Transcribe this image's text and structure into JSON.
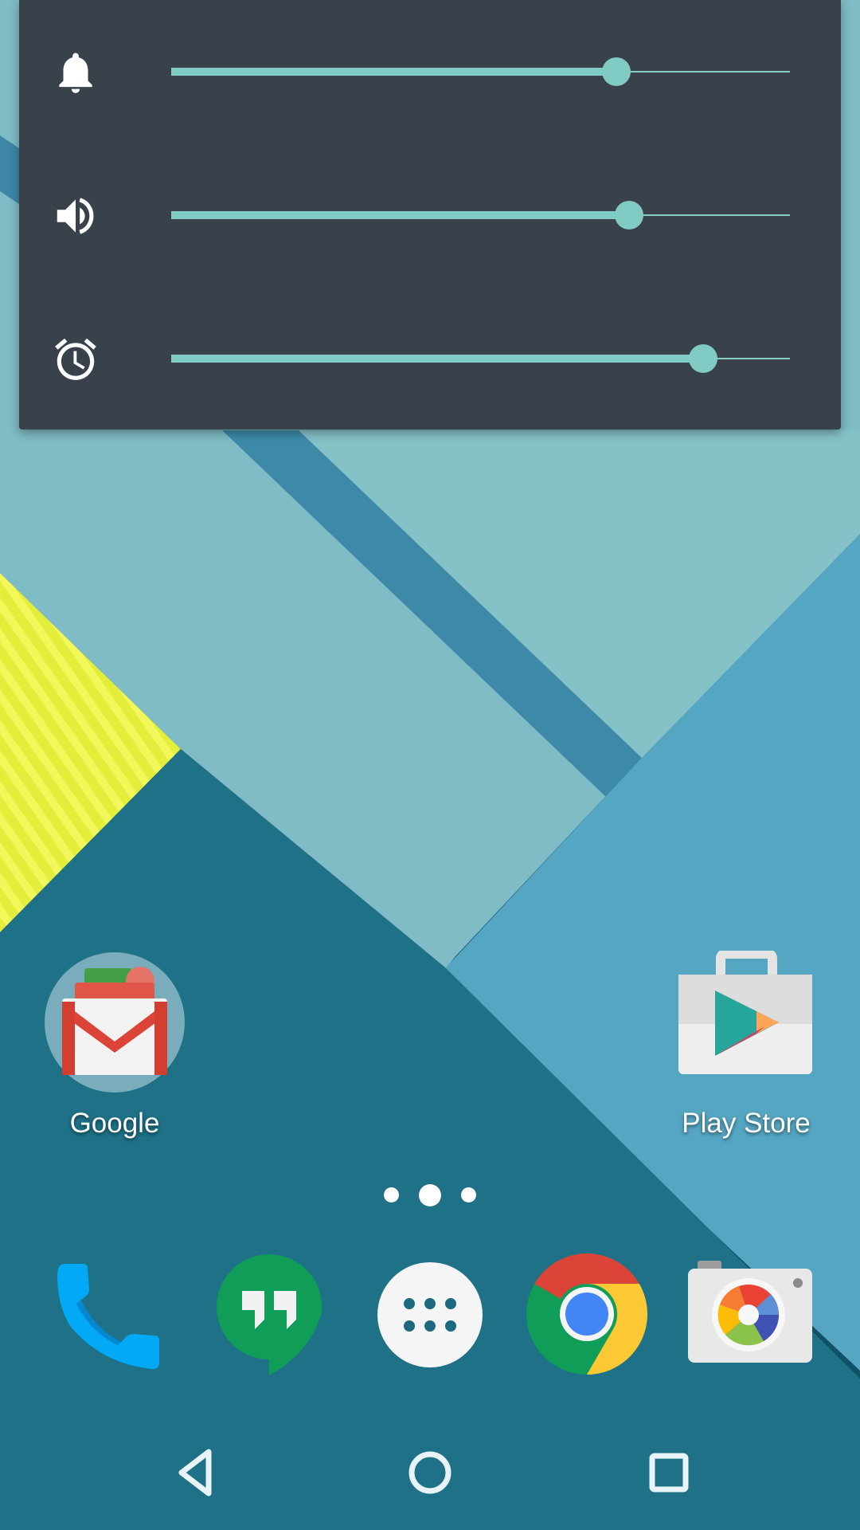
{
  "screen": {
    "type": "android-home-screen",
    "wallpaper": "material-lollipop-paper"
  },
  "volume_panel": {
    "sliders": [
      {
        "id": "ringer",
        "icon": "bell-icon",
        "level": 0.72
      },
      {
        "id": "media",
        "icon": "speaker-icon",
        "level": 0.74
      },
      {
        "id": "alarm",
        "icon": "alarm-clock-icon",
        "level": 0.86
      }
    ],
    "accent_color": "#80cbc4",
    "background_color": "#39414a"
  },
  "home": {
    "apps": [
      {
        "id": "google-folder",
        "label": "Google",
        "icon": "gmail-folder-icon"
      },
      {
        "id": "play-store",
        "label": "Play Store",
        "icon": "play-store-icon"
      }
    ],
    "page_indicator": {
      "pages": 3,
      "current": 2
    }
  },
  "dock": {
    "apps": [
      {
        "id": "phone",
        "icon": "phone-icon"
      },
      {
        "id": "hangouts",
        "icon": "hangouts-icon"
      },
      {
        "id": "app-drawer",
        "icon": "app-drawer-icon"
      },
      {
        "id": "chrome",
        "icon": "chrome-icon"
      },
      {
        "id": "camera",
        "icon": "camera-icon"
      }
    ]
  },
  "navbar": {
    "buttons": [
      {
        "id": "back",
        "icon": "back-icon"
      },
      {
        "id": "home",
        "icon": "home-icon"
      },
      {
        "id": "recents",
        "icon": "recents-icon"
      }
    ]
  }
}
